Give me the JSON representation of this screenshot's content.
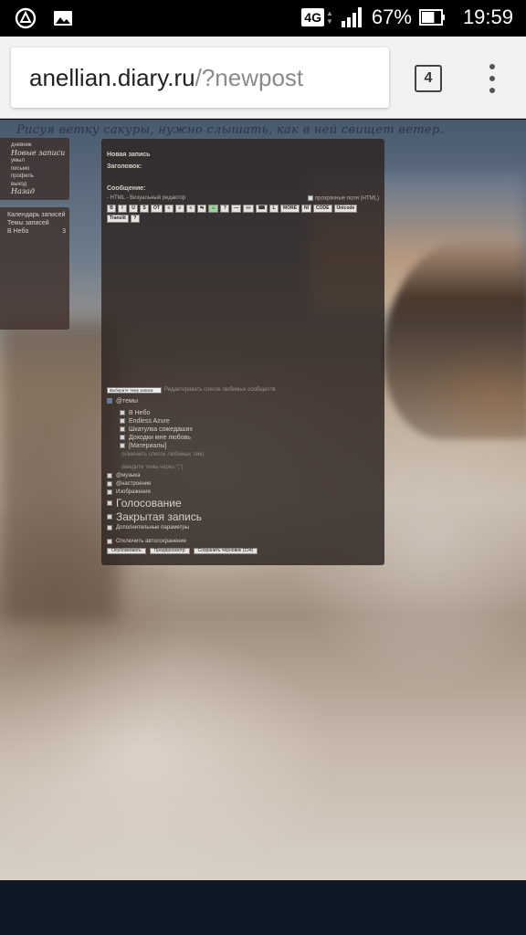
{
  "status_bar": {
    "network": "4G",
    "battery_percent": "67%",
    "battery_level": 0.67,
    "time": "19:59",
    "left_icons": [
      "assistant-icon",
      "gallery-icon"
    ]
  },
  "browser": {
    "url_host": "anellian.diary.ru",
    "url_path": "/?newpost",
    "tabs_count": "4"
  },
  "page": {
    "tagline": "Рисуя ветку сакуры, нужно слышать, как в ней свищет ветер.",
    "side_menu": [
      "дневник",
      "Новые записи",
      "умыл",
      "письмо",
      "профиль",
      "выход",
      "Назад"
    ],
    "calendar_widget": {
      "links": [
        "Календарь записей",
        "Темы записей"
      ],
      "count_label": "В Небо",
      "count_value": "3"
    },
    "form": {
      "heading": "Новая запись",
      "title_label": "Заголовок:",
      "message_label": "Сообщение:",
      "html_hint": "- HTML - Визуальный редактор",
      "transparent_fields": "прозрачные поля (HTML)",
      "toolbar_buttons": [
        "B",
        "I",
        "U",
        "S",
        "OT",
        "≡",
        "≡",
        "≡",
        "⇆",
        "☺",
        "?",
        "—",
        "«»",
        "⌨",
        "L",
        "MORE",
        "NI",
        "CODE",
        "Unicode",
        "Translit",
        "?"
      ],
      "community_select": "Выберите тему записи",
      "edit_favorites_link": "Редактировать список любимых сообществ",
      "themes_label": "@темы",
      "themes": [
        "В Небо",
        "Endless Azure",
        "Шкатулка сожедаших",
        "Доходки мне любовь",
        "[Материалы]"
      ],
      "edit_themes_link": "(изменить список любимых тем)",
      "themes_hint": "(введите темы через \";\")",
      "fields": [
        "@музыка",
        "@настроение",
        "Изображения"
      ],
      "poll_label": "Голосование",
      "closed_label": "Закрытая запись",
      "extra_params": "Дополнительные параметры",
      "autosave_label": "Отключить автосохранение",
      "publish_button": "Опубликовать",
      "preview_button": "Предпросмотр",
      "save_draft_button": "Сохранить черновик (104)"
    }
  }
}
